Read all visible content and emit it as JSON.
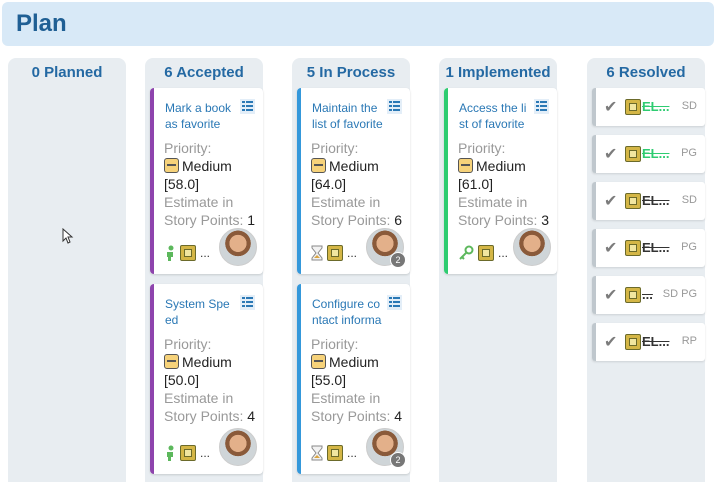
{
  "header": {
    "title": "Plan"
  },
  "columns": [
    {
      "title": "0 Planned"
    },
    {
      "title": "6 Accepted"
    },
    {
      "title": "5 In Process"
    },
    {
      "title": "1 Implemented"
    },
    {
      "title": "6 Resolved"
    }
  ],
  "cards": {
    "accepted": [
      {
        "title": "Mark a book as favorite",
        "priority_label": "Priority:",
        "priority": "Medium",
        "score": "[58.0]",
        "estimate_label1": "Estimate in",
        "estimate_label2": "Story Points:",
        "points": "1",
        "ellipsis": "...",
        "state_icon": "person-icon",
        "accent": "#8e44ad"
      },
      {
        "title": "System Spe ed",
        "priority_label": "Priority:",
        "priority": "Medium",
        "score": "[50.0]",
        "estimate_label1": "Estimate in",
        "estimate_label2": "Story Points:",
        "points": "4",
        "ellipsis": "...",
        "state_icon": "person-icon",
        "accent": "#8e44ad"
      }
    ],
    "in_process": [
      {
        "title": "Maintain the list of favorite",
        "priority_label": "Priority:",
        "priority": "Medium",
        "score": "[64.0]",
        "estimate_label1": "Estimate in",
        "estimate_label2": "Story Points:",
        "points": "6",
        "ellipsis": "...",
        "badge": "2",
        "state_icon": "hourglass-icon",
        "accent": "#3498db"
      },
      {
        "title": "Configure co ntact informa",
        "priority_label": "Priority:",
        "priority": "Medium",
        "score": "[55.0]",
        "estimate_label1": "Estimate in",
        "estimate_label2": "Story Points:",
        "points": "4",
        "ellipsis": "...",
        "badge": "2",
        "state_icon": "hourglass-icon",
        "accent": "#3498db"
      }
    ],
    "implemented": [
      {
        "title": "Access the li st of favorite",
        "priority_label": "Priority:",
        "priority": "Medium",
        "score": "[61.0]",
        "estimate_label1": "Estimate in",
        "estimate_label2": "Story Points:",
        "points": "3",
        "ellipsis": "...",
        "state_icon": "key-icon",
        "accent": "#2ecc71"
      }
    ]
  },
  "resolved": [
    {
      "key": "EL...",
      "owner": "SD",
      "key_color": "#2ecc71"
    },
    {
      "key": "EL...",
      "owner": "PG",
      "key_color": "#2ecc71"
    },
    {
      "key": "EL...",
      "owner": "SD",
      "key_color": "#333333"
    },
    {
      "key": "EL...",
      "owner": "PG",
      "key_color": "#333333"
    },
    {
      "key": "...",
      "owner": "SD PG",
      "key_color": "#333333"
    },
    {
      "key": "EL...",
      "owner": "RP",
      "key_color": "#333333"
    }
  ]
}
